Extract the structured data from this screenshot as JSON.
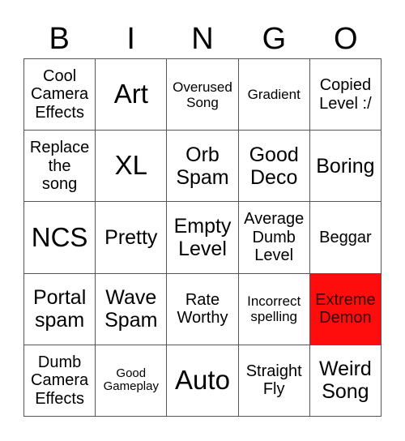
{
  "header": {
    "letters": [
      "B",
      "I",
      "N",
      "G",
      "O"
    ]
  },
  "board": {
    "marked_color": "#FF0D0D",
    "cells": [
      {
        "text": "Cool\nCamera\nEffects",
        "marked": false
      },
      {
        "text": "Art",
        "marked": false
      },
      {
        "text": "Overused\nSong",
        "marked": false
      },
      {
        "text": "Gradient",
        "marked": false
      },
      {
        "text": "Copied\nLevel :/",
        "marked": false
      },
      {
        "text": "Replace\nthe\nsong",
        "marked": false
      },
      {
        "text": "XL",
        "marked": false
      },
      {
        "text": "Orb\nSpam",
        "marked": false
      },
      {
        "text": "Good\nDeco",
        "marked": false
      },
      {
        "text": "Boring",
        "marked": false
      },
      {
        "text": "NCS",
        "marked": false
      },
      {
        "text": "Pretty",
        "marked": false
      },
      {
        "text": "Empty\nLevel",
        "marked": false
      },
      {
        "text": "Average\nDumb\nLevel",
        "marked": false
      },
      {
        "text": "Beggar",
        "marked": false
      },
      {
        "text": "Portal\nspam",
        "marked": false
      },
      {
        "text": "Wave\nSpam",
        "marked": false
      },
      {
        "text": "Rate\nWorthy",
        "marked": false
      },
      {
        "text": "Incorrect\nspelling",
        "marked": false
      },
      {
        "text": "Extreme\nDemon",
        "marked": true
      },
      {
        "text": "Dumb\nCamera\nEffects",
        "marked": false
      },
      {
        "text": "Good\nGameplay",
        "marked": false
      },
      {
        "text": "Auto",
        "marked": false
      },
      {
        "text": "Straight\nFly",
        "marked": false
      },
      {
        "text": "Weird\nSong",
        "marked": false
      }
    ]
  }
}
